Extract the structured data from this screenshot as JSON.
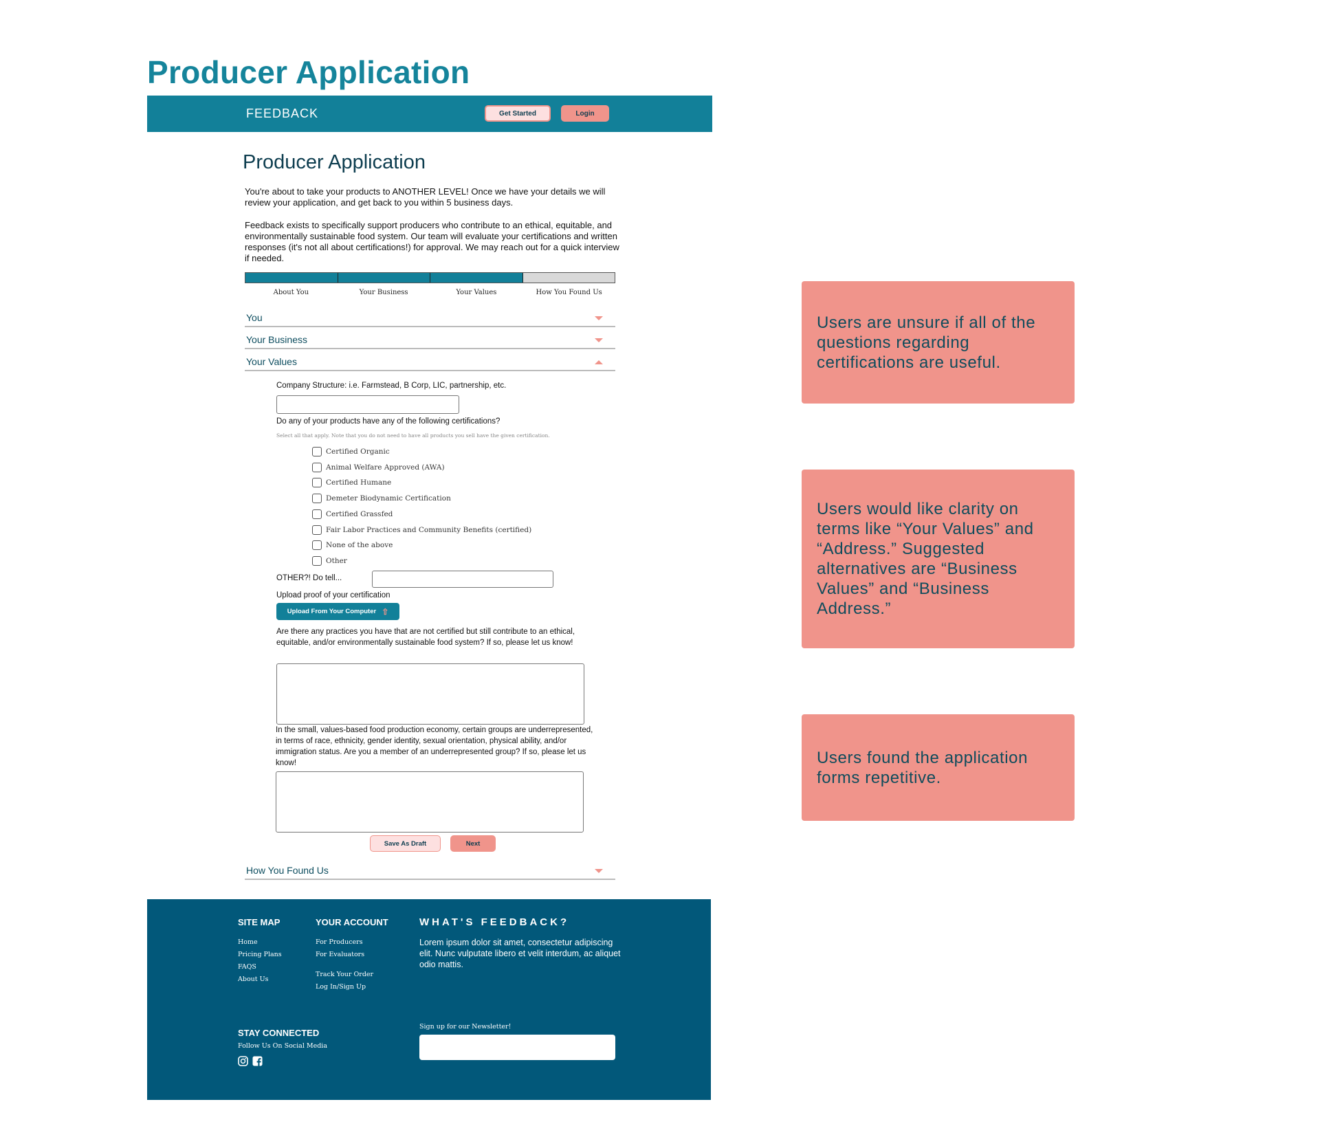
{
  "page_title": "Producer Application",
  "nav": {
    "brand": "FEEDBACK",
    "get_started": "Get Started",
    "login": "Login"
  },
  "form": {
    "heading": "Producer Application",
    "intro_1": "You're about to take your products to ANOTHER LEVEL! Once we have your details we will review your application, and get back to you within 5 business days.",
    "intro_2": "Feedback exists to specifically support producers who contribute to an ethical, equitable, and environmentally sustainable food system. Our team will evaluate your certifications and written responses (it's not all about certifications!) for approval. We may reach out for a quick interview if needed.",
    "progress": {
      "steps": [
        "About You",
        "Your Business",
        "Your Values",
        "How You Found Us"
      ],
      "completed_steps": 3,
      "fill_color": "#128099",
      "empty_color": "#d9d9d9"
    },
    "sections": {
      "you": "You",
      "business": "Your Business",
      "values": "Your Values",
      "found_us": "How You Found Us"
    },
    "company_structure_label": "Company Structure: i.e. Farmstead, B Corp, LIC, partnership, etc.",
    "company_structure_value": "",
    "cert_question": "Do any of your products have any of the following certifications?",
    "cert_note": "Select all that apply. Note that you do not need to have all products you sell have the given certification.",
    "certifications": [
      "Certified Organic",
      "Animal Welfare Approved (AWA)",
      "Certified Humane",
      "Demeter Biodynamic Certification",
      "Certified Grassfed",
      "Fair Labor Practices and Community Benefits (certified)",
      "None of the above",
      "Other"
    ],
    "other_label": "OTHER?! Do tell...",
    "other_value": "",
    "upload_label": "Upload proof of your certification",
    "upload_button": "Upload From Your Computer",
    "practices_question": "Are there any practices you have that are not certified but still contribute to an ethical, equitable, and/or environmentally sustainable food system? If so, please let us know!",
    "underrep_question": "In the small, values-based food production economy, certain groups are underrepresented, in terms of race, ethnicity, gender identity, sexual orientation, physical ability, and/or immigration status. Are you a member of an underrepresented group? If so, please let us know!",
    "save_draft": "Save As Draft",
    "next": "Next"
  },
  "footer": {
    "site_map": {
      "title": "SITE MAP",
      "links": [
        "Home",
        "Pricing Plans",
        "FAQS",
        "About Us"
      ]
    },
    "account": {
      "title": "YOUR ACCOUNT",
      "links": [
        "For Producers",
        "For Evaluators",
        "Track Your Order",
        "Log In/Sign Up"
      ]
    },
    "about": {
      "title": "WHAT'S FEEDBACK?",
      "text": "Lorem ipsum dolor sit amet, consectetur adipiscing elit. Nunc vulputate libero et velit interdum, ac aliquet odio mattis."
    },
    "social": {
      "title": "STAY CONNECTED",
      "subtitle": "Follow Us On Social Media",
      "icons": [
        "instagram-icon",
        "facebook-icon"
      ]
    },
    "newsletter": {
      "label": "Sign up for our Newsletter!",
      "value": ""
    }
  },
  "notes": [
    "Users are unsure if all of the questions regarding certifications are useful.",
    "Users would like clarity on terms like “Your Values” and “Address.” Suggested alternatives are “Business Values” and “Business Address.”",
    "Users found the application forms repetitive."
  ],
  "colors": {
    "brand_teal": "#128099",
    "footer_blue": "#02587a",
    "accent_salmon": "#f0948b",
    "light_pink": "#fde0e0",
    "text_dark": "#0d3d4f"
  }
}
